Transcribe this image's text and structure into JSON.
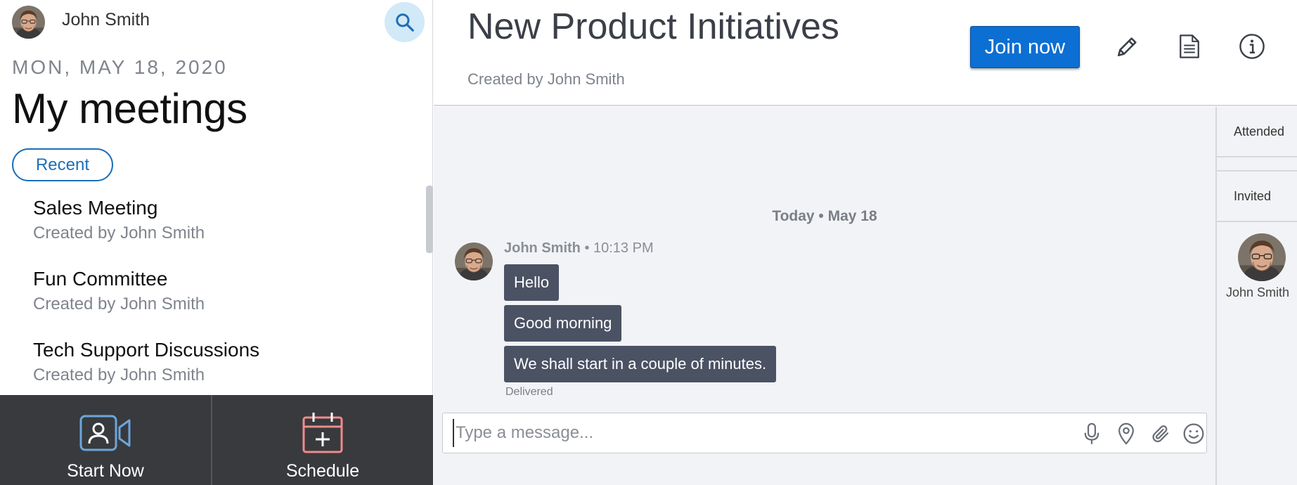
{
  "user": {
    "name": "John Smith"
  },
  "sidebar": {
    "date": "MON, MAY 18, 2020",
    "title": "My meetings",
    "filter_label": "Recent",
    "meetings": [
      {
        "title": "Sales Meeting",
        "subtitle": "Created by John Smith"
      },
      {
        "title": "Fun Committee",
        "subtitle": "Created by John Smith"
      },
      {
        "title": "Tech Support Discussions",
        "subtitle": "Created by John Smith"
      }
    ]
  },
  "bottom_bar": {
    "start_label": "Start Now",
    "schedule_label": "Schedule"
  },
  "header": {
    "meeting_title": "New Product Initiatives",
    "created_by": "Created by John Smith",
    "join_label": "Join now",
    "icons": [
      "pencil-icon",
      "document-icon",
      "info-icon"
    ]
  },
  "chat": {
    "day_divider": "Today • May 18",
    "author": "John Smith",
    "time": " • 10:13 PM",
    "messages": [
      "Hello",
      "Good morning",
      "We shall start in a couple of minutes."
    ],
    "status": "Delivered",
    "composer_placeholder": "Type a message...",
    "composer_icons": [
      "microphone-icon",
      "location-icon",
      "attachment-icon",
      "emoji-icon"
    ]
  },
  "participants": {
    "tabs": [
      "Attended",
      "Invited"
    ],
    "people": [
      {
        "name": "John Smith"
      }
    ]
  },
  "colors": {
    "accent": "#0c6fd3",
    "bubble": "#4b5264",
    "bottom_bar": "#383a3d",
    "chat_bg": "#f2f3f6",
    "schedule_icon": "#f08b8b",
    "start_icon": "#6ca6dc"
  }
}
